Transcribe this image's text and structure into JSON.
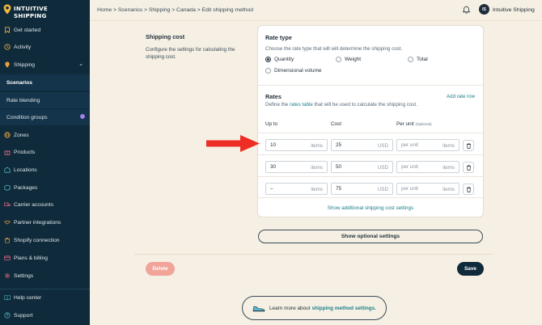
{
  "brand": {
    "line1": "INTUITIVE",
    "line2": "SHIPPING"
  },
  "sidebar": {
    "items": [
      {
        "label": "Get started",
        "icon": "bookmark-icon"
      },
      {
        "label": "Activity",
        "icon": "activity-icon"
      },
      {
        "label": "Shipping",
        "icon": "pin-icon"
      },
      {
        "label": "Scenarios"
      },
      {
        "label": "Rate blending"
      },
      {
        "label": "Condition groups"
      },
      {
        "label": "Zones",
        "icon": "globe-icon"
      },
      {
        "label": "Products",
        "icon": "gift-icon"
      },
      {
        "label": "Locations",
        "icon": "warehouse-icon"
      },
      {
        "label": "Packages",
        "icon": "package-icon"
      },
      {
        "label": "Carrier accounts",
        "icon": "truck-icon"
      },
      {
        "label": "Partner integrations",
        "icon": "handshake-icon"
      },
      {
        "label": "Shopify connection",
        "icon": "shopify-icon"
      },
      {
        "label": "Plans & billing",
        "icon": "card-icon"
      },
      {
        "label": "Settings",
        "icon": "gear-icon"
      },
      {
        "label": "Help center",
        "icon": "book-icon"
      },
      {
        "label": "Support",
        "icon": "help-icon"
      }
    ]
  },
  "topbar": {
    "breadcrumb": "Home > Scenarios > Shipping > Canada > Edit shipping method",
    "user_initials": "IS",
    "user_name": "Intuitive Shipping"
  },
  "section": {
    "title": "Shipping cost",
    "description": "Configure the settings for calculating the shipping cost."
  },
  "rate_type": {
    "title": "Rate type",
    "help": "Choose the rate type that will will determine the shipping cost.",
    "options": [
      "Quantity",
      "Weight",
      "Total",
      "Dimensional volume"
    ],
    "selected": "Quantity"
  },
  "rates": {
    "title": "Rates",
    "add_label": "Add rate row",
    "help_prefix": "Define the ",
    "help_link": "rates table",
    "help_suffix": " that will be used to calculate the shipping cost.",
    "col_upto": "Up to",
    "col_cost": "Cost",
    "col_perunit": "Per unit",
    "col_perunit_note": "(Optional)",
    "rows": [
      {
        "upto": "10",
        "upto_unit": "items",
        "cost": "25",
        "currency": "USD",
        "perunit_placeholder": "per unit",
        "perunit_unit": "items"
      },
      {
        "upto": "30",
        "upto_unit": "items",
        "cost": "50",
        "currency": "USD",
        "perunit_placeholder": "per unit",
        "perunit_unit": "items"
      },
      {
        "upto": "–",
        "upto_unit": "items",
        "cost": "75",
        "currency": "USD",
        "perunit_placeholder": "per unit",
        "perunit_unit": "items"
      }
    ],
    "show_additional": "Show additional shipping cost settings"
  },
  "buttons": {
    "optional": "Show optional settings",
    "delete": "Delete",
    "save": "Save"
  },
  "learn_more": {
    "prefix": "Learn more about",
    "link": "shipping method settings."
  },
  "colors": {
    "sidebar_bg": "#0f2a3a",
    "page_bg": "#f5f0e3",
    "accent_orange": "#e6a33a",
    "link_teal": "#1d7f8a",
    "delete_pink": "#f1a49a",
    "arrow_red": "#ee2d24"
  }
}
